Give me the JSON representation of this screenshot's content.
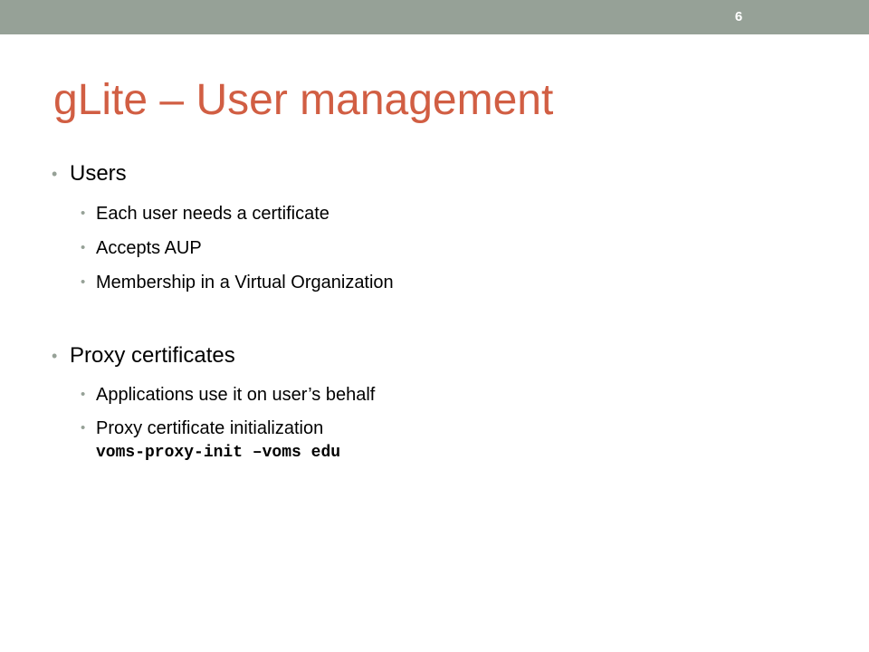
{
  "slide": {
    "number": "6",
    "title": "gLite – User management"
  },
  "bullets": {
    "users": {
      "label": "Users",
      "items": [
        "Each user needs a certificate",
        "Accepts AUP",
        "Membership in a Virtual Organization"
      ]
    },
    "proxy": {
      "label": "Proxy certificates",
      "items": [
        "Applications use it on user’s behalf",
        "Proxy certificate initialization"
      ],
      "command": "voms-proxy-init –voms edu"
    }
  },
  "bullet_symbol": "•",
  "colors": {
    "top_bar": "#96a197",
    "title": "#d15e43",
    "text": "#000000",
    "bullet": "#96a197"
  }
}
